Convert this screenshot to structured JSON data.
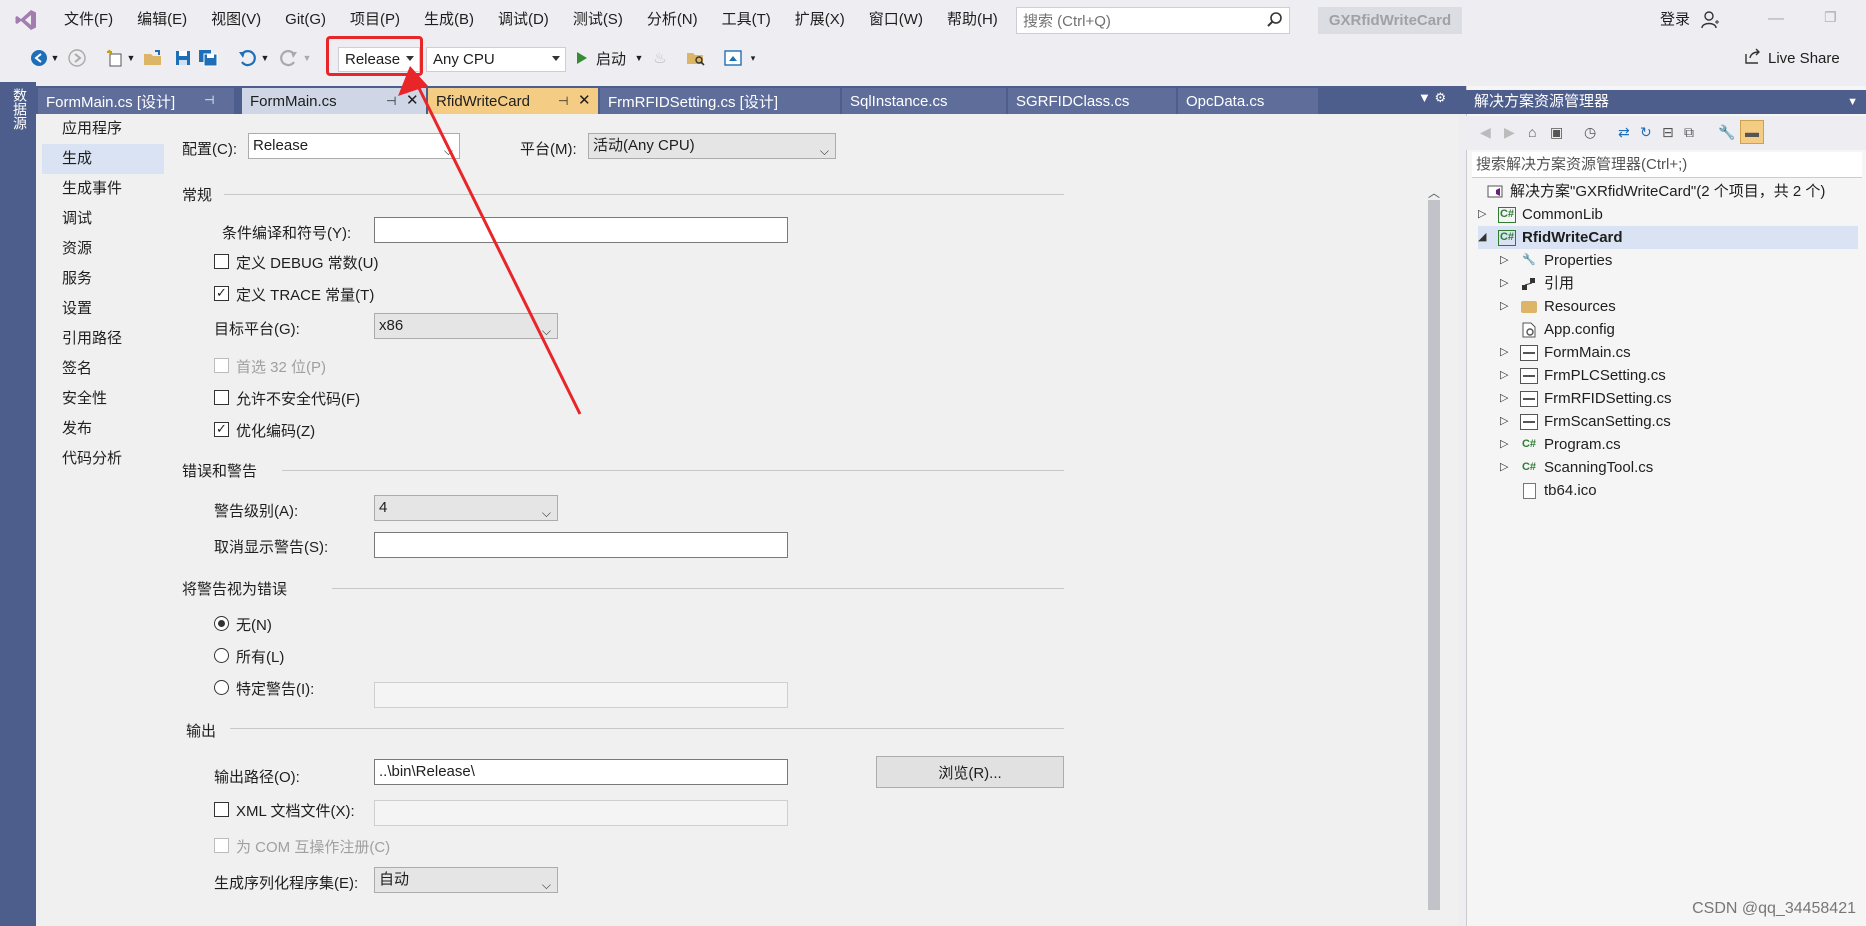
{
  "menubar": {
    "items": [
      "文件(F)",
      "编辑(E)",
      "视图(V)",
      "Git(G)",
      "项目(P)",
      "生成(B)",
      "调试(D)",
      "测试(S)",
      "分析(N)",
      "工具(T)",
      "扩展(X)",
      "窗口(W)",
      "帮助(H)"
    ],
    "search_placeholder": "搜索 (Ctrl+Q)",
    "solution_name": "GXRfidWriteCard",
    "login_label": "登录"
  },
  "toolbar": {
    "config_value": "Release",
    "platform_value": "Any CPU",
    "start_label": "启动",
    "live_share_label": "Live Share"
  },
  "left_strip": {
    "tab_label": "数据源"
  },
  "doc_tabs": [
    {
      "label": "FormMain.cs [设计]"
    },
    {
      "label": "FormMain.cs"
    },
    {
      "label": "RfidWriteCard"
    },
    {
      "label": "FrmRFIDSetting.cs [设计]"
    },
    {
      "label": "SqlInstance.cs"
    },
    {
      "label": "SGRFIDClass.cs"
    },
    {
      "label": "OpcData.cs"
    }
  ],
  "nav": {
    "items": [
      "应用程序",
      "生成",
      "生成事件",
      "调试",
      "资源",
      "服务",
      "设置",
      "引用路径",
      "签名",
      "安全性",
      "发布",
      "代码分析"
    ]
  },
  "build": {
    "config_label": "配置(C):",
    "config_value": "Release",
    "platform_label": "平台(M):",
    "platform_value": "活动(Any CPU)",
    "general_header": "常规",
    "cond_symbols_label": "条件编译和符号(Y):",
    "cond_symbols_value": "",
    "define_debug_label": "定义 DEBUG 常数(U)",
    "define_trace_label": "定义 TRACE 常量(T)",
    "target_platform_label": "目标平台(G):",
    "target_platform_value": "x86",
    "prefer32_label": "首选 32 位(P)",
    "unsafe_label": "允许不安全代码(F)",
    "optimize_label": "优化编码(Z)",
    "errors_header": "错误和警告",
    "warn_level_label": "警告级别(A):",
    "warn_level_value": "4",
    "suppress_label": "取消显示警告(S):",
    "suppress_value": "",
    "treat_header": "将警告视为错误",
    "radio_none": "无(N)",
    "radio_all": "所有(L)",
    "radio_specific": "特定警告(I):",
    "output_header": "输出",
    "output_path_label": "输出路径(O):",
    "output_path_value": "..\\bin\\Release\\",
    "browse_label": "浏览(R)...",
    "xml_doc_label": "XML 文档文件(X):",
    "com_label": "为 COM 互操作注册(C)",
    "serialization_label": "生成序列化程序集(E):",
    "serialization_value": "自动"
  },
  "checkboxes": {
    "define_debug": false,
    "define_trace": true,
    "prefer32": false,
    "unsafe": false,
    "optimize": true,
    "xml_doc": false,
    "com": false
  },
  "solution_explorer": {
    "title": "解决方案资源管理器",
    "search_placeholder": "搜索解决方案资源管理器(Ctrl+;)",
    "tree": [
      {
        "label": "解决方案\"GXRfidWriteCard\"(2 个项目，共 2 个)",
        "icon": "solution-icon"
      },
      {
        "label": "CommonLib",
        "icon": "csharp-project-icon"
      },
      {
        "label": "RfidWriteCard",
        "icon": "csharp-project-icon"
      },
      {
        "label": "Properties",
        "icon": "wrench-icon"
      },
      {
        "label": "引用",
        "icon": "references-icon"
      },
      {
        "label": "Resources",
        "icon": "folder-icon"
      },
      {
        "label": "App.config",
        "icon": "config-file-icon"
      },
      {
        "label": "FormMain.cs",
        "icon": "form-icon"
      },
      {
        "label": "FrmPLCSetting.cs",
        "icon": "form-icon"
      },
      {
        "label": "FrmRFIDSetting.cs",
        "icon": "form-icon"
      },
      {
        "label": "FrmScanSetting.cs",
        "icon": "form-icon"
      },
      {
        "label": "Program.cs",
        "icon": "csharp-file-icon"
      },
      {
        "label": "ScanningTool.cs",
        "icon": "csharp-file-icon"
      },
      {
        "label": "tb64.ico",
        "icon": "ico-file-icon"
      }
    ]
  },
  "watermark": "CSDN @qq_34458421",
  "colors": {
    "accent": "#4d5d8c",
    "active_tab": "#f5cc84",
    "highlight_red": "#e8262a"
  }
}
